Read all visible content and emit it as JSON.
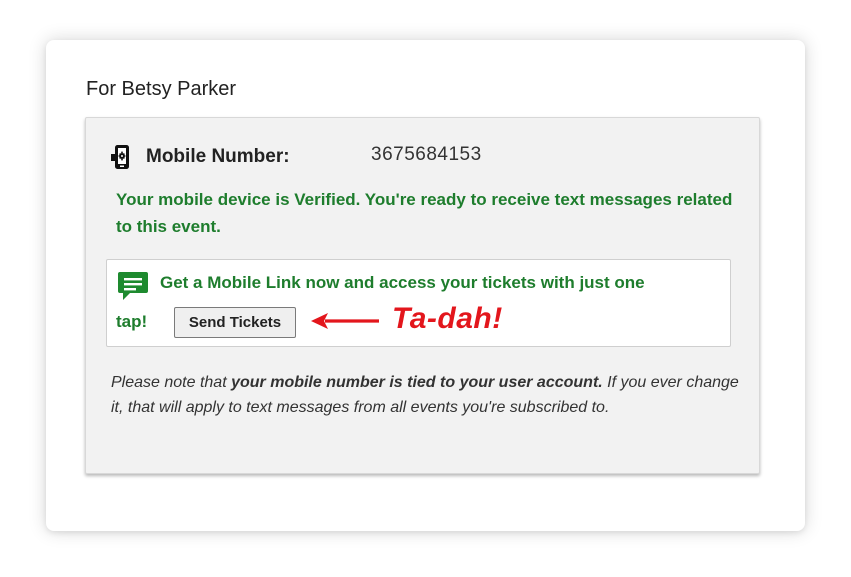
{
  "account": {
    "for_name": "For Betsy Parker"
  },
  "mobile": {
    "icon": "mobile-settings-icon",
    "label": "Mobile Number:",
    "value": "3675684153",
    "verified_message": "Your mobile device is Verified. You're ready to receive text messages related to this event."
  },
  "mobile_link": {
    "icon": "chat-bubble-icon",
    "message_line1": "Get a Mobile Link now and access your tickets with just one",
    "message_line2": "tap!",
    "button_label": "Send Tickets",
    "annotation_text": "Ta-dah!",
    "annotation_icon": "arrow-left-icon"
  },
  "note": {
    "prefix": "Please note that ",
    "emphasis": "your mobile number is tied to your user account.",
    "suffix": " If you ever change it, that will apply to text messages from all events you're subscribed to."
  },
  "colors": {
    "verified_green": "#1e7d2d",
    "annotation_red": "#e3161c",
    "panel_gray": "#f2f2f2"
  }
}
